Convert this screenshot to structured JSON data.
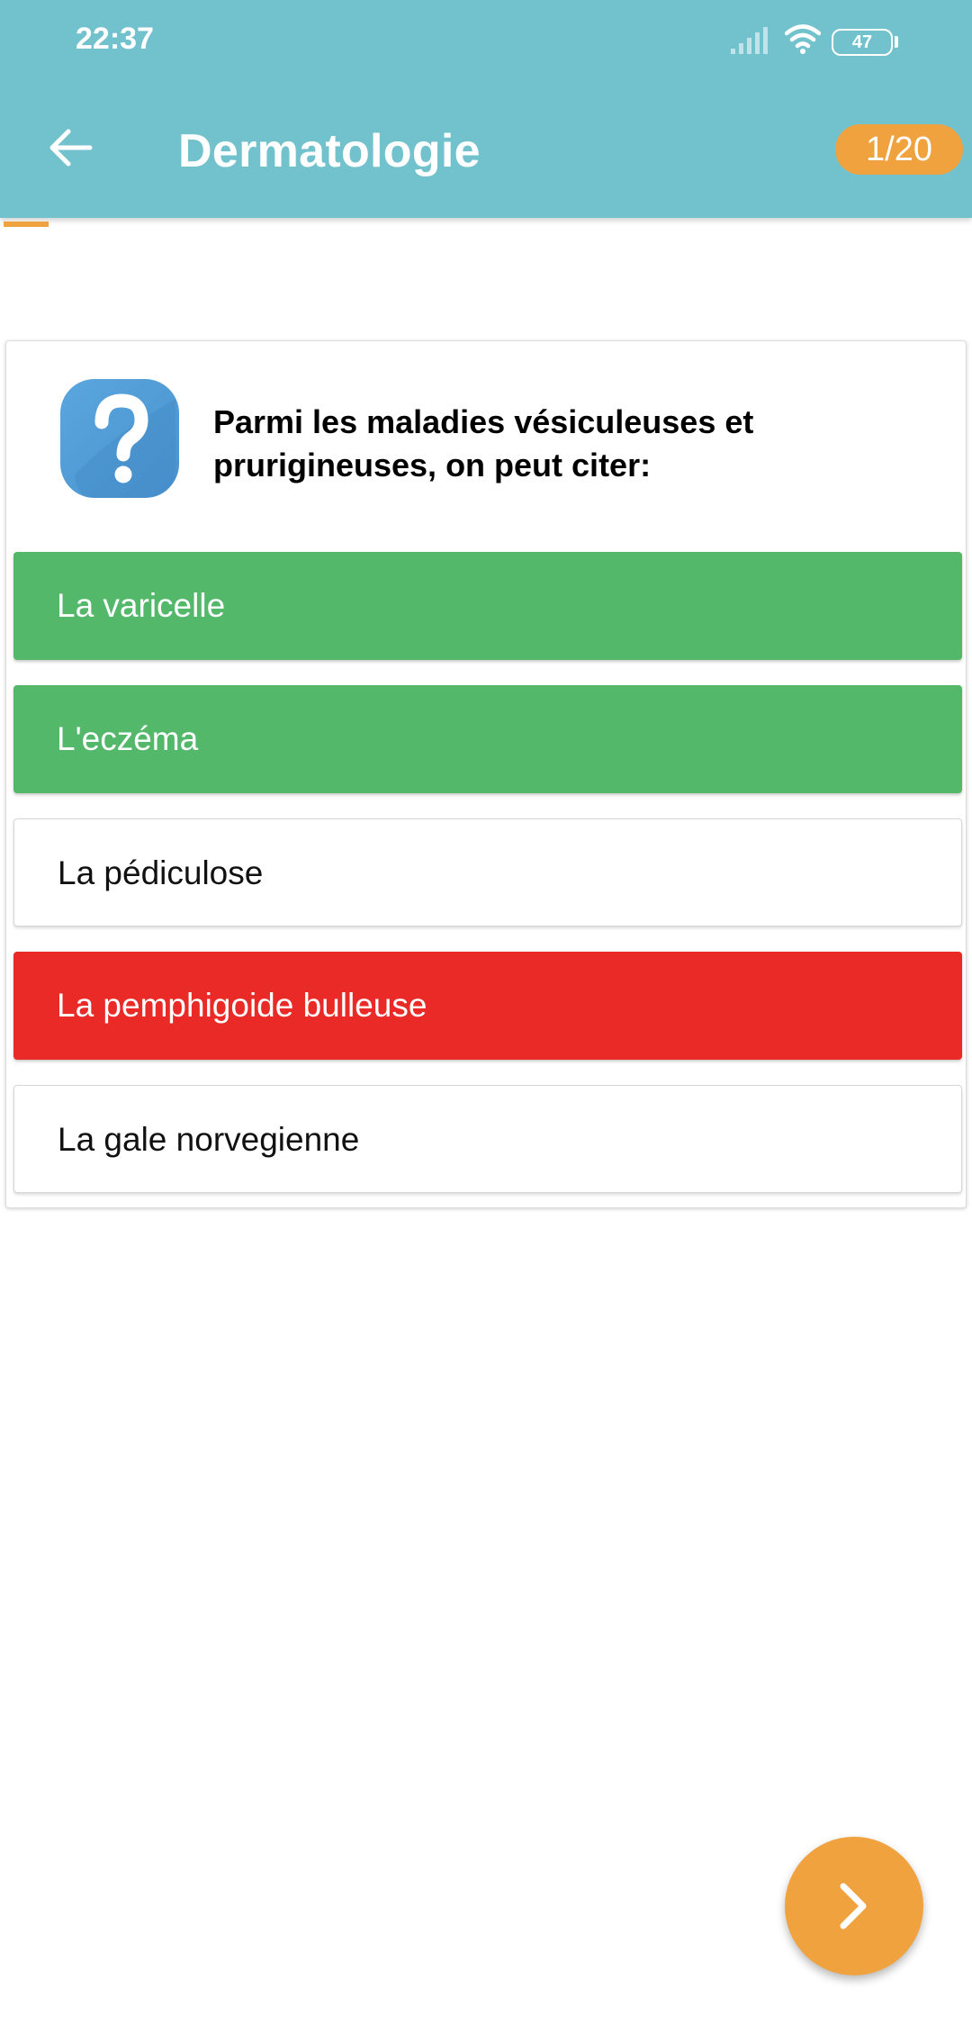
{
  "status_bar": {
    "time": "22:37",
    "battery_level": "47",
    "icons": [
      "signal-icon",
      "wifi-icon",
      "battery-icon"
    ]
  },
  "header": {
    "back_icon": "arrow-left-icon",
    "title": "Dermatologie",
    "counter": "1/20",
    "accent_color": "#72c2ce",
    "badge_color": "#f0a23f"
  },
  "progress": {
    "current": 1,
    "total": 20
  },
  "question": {
    "icon": "question-mark-icon",
    "text": "Parmi les maladies vésiculeuses et prurigineuses, on peut citer:"
  },
  "answers": [
    {
      "label": "La varicelle",
      "state": "correct"
    },
    {
      "label": "L'eczéma",
      "state": "correct"
    },
    {
      "label": "La pédiculose",
      "state": "neutral"
    },
    {
      "label": "La pemphigoide bulleuse",
      "state": "wrong"
    },
    {
      "label": "La gale norvegienne",
      "state": "neutral"
    }
  ],
  "colors": {
    "correct": "#54b86b",
    "wrong": "#e92a26",
    "neutral": "#ffffff"
  },
  "next_button": {
    "icon": "chevron-right-icon"
  }
}
